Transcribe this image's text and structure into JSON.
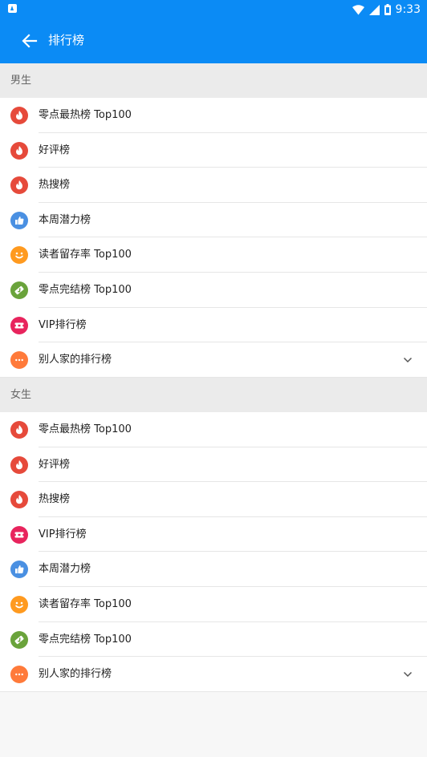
{
  "status_bar": {
    "time": "9:33"
  },
  "app_bar": {
    "title": "排行榜"
  },
  "colors": {
    "primary": "#0b8bf5",
    "red": "#e64a3b",
    "blue": "#4a90e2",
    "orange": "#ff9a1f",
    "green": "#6aa33b",
    "pink": "#e8245d",
    "coral": "#ff7a3a"
  },
  "sections": [
    {
      "header": "男生",
      "items": [
        {
          "label": "零点最热榜 Top100",
          "icon": "flame-icon"
        },
        {
          "label": "好评榜",
          "icon": "flame-icon"
        },
        {
          "label": "热搜榜",
          "icon": "flame-icon"
        },
        {
          "label": "本周潜力榜",
          "icon": "thumbs-up-icon"
        },
        {
          "label": "读者留存率 Top100",
          "icon": "smile-icon"
        },
        {
          "label": "零点完结榜 Top100",
          "icon": "finish-icon"
        },
        {
          "label": "VIP排行榜",
          "icon": "ticket-icon"
        },
        {
          "label": "别人家的排行榜",
          "icon": "more-icon"
        }
      ]
    },
    {
      "header": "女生",
      "items": [
        {
          "label": "零点最热榜 Top100",
          "icon": "flame-icon"
        },
        {
          "label": "好评榜",
          "icon": "flame-icon"
        },
        {
          "label": "热搜榜",
          "icon": "flame-icon"
        },
        {
          "label": "VIP排行榜",
          "icon": "ticket-icon"
        },
        {
          "label": "本周潜力榜",
          "icon": "thumbs-up-icon"
        },
        {
          "label": "读者留存率 Top100",
          "icon": "smile-icon"
        },
        {
          "label": "零点完结榜 Top100",
          "icon": "finish-icon"
        },
        {
          "label": "别人家的排行榜",
          "icon": "more-icon"
        }
      ]
    }
  ]
}
